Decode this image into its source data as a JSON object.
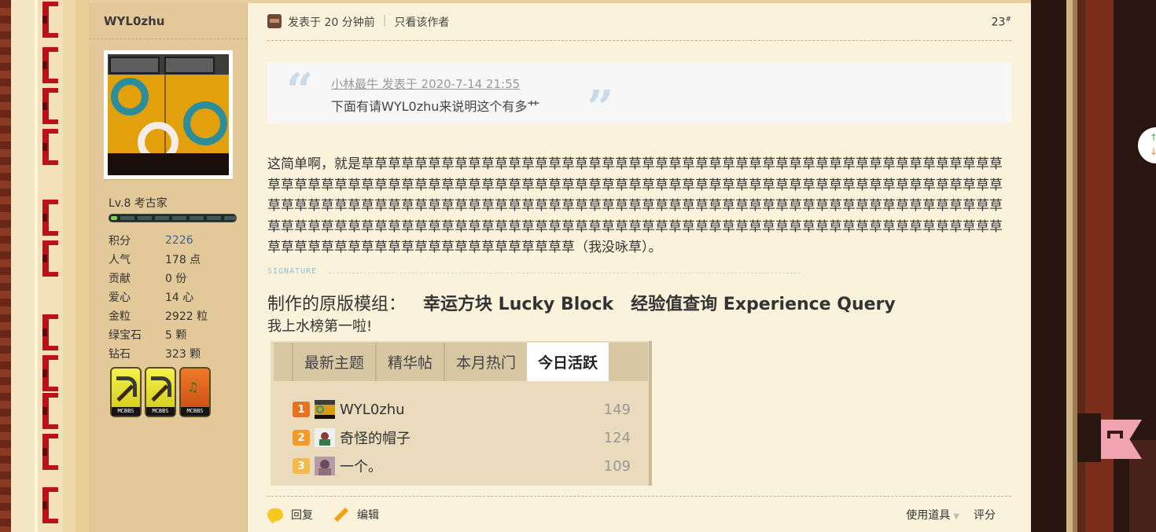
{
  "author": {
    "name": "WYL0zhu",
    "level": "Lv.8 考古家",
    "level_progress": 0.05,
    "stats": [
      {
        "label": "积分",
        "value": "2226"
      },
      {
        "label": "人气",
        "value": "178 点"
      },
      {
        "label": "贡献",
        "value": "0 份"
      },
      {
        "label": "爱心",
        "value": "14 心"
      },
      {
        "label": "金粒",
        "value": "2922 粒"
      },
      {
        "label": "绿宝石",
        "value": "5 颗"
      },
      {
        "label": "钻石",
        "value": "323 颗"
      }
    ],
    "medals": [
      {
        "tag": "MCBBS",
        "icon": "pickaxe-icon",
        "color": "#e6e030"
      },
      {
        "tag": "MCBBS",
        "icon": "pickaxe-icon",
        "color": "#e6e030"
      },
      {
        "tag": "MCBBS",
        "icon": "music-notes-icon",
        "color": "#e0641e"
      }
    ]
  },
  "post": {
    "time": "发表于 20 分钟前",
    "separator": "|",
    "only_author": "只看该作者",
    "floor": "23",
    "floor_sup": "#",
    "quote": {
      "open_mark": "“",
      "close_mark": "”",
      "head": "小林最牛 发表于 2020-7-14 21:55",
      "body": "下面有请WYL0zhu来说明这个有多艹"
    },
    "message": "这简单啊，就是草草草草草草草草草草草草草草草草草草草草草草草草草草草草草草草草草草草草草草草草草草草草草草草草草草草草草草草草草草草草草草草草草草草草草草草草草草草草草草草草草草草草草草草草草草草草草草草草草草草草草草草草草草草草草草草草草草草草草草草草草草草草草草草草草草草草草草草草草草草草草草草草草草草草草草草草草草草草草草草草草草草草草草草草草草草草草草草草草草草草草草草草草草草草草草草草草草草草草草草草草草草草草草草草草草草草草草草草草草草草草草草草草草草草草草草草草草草草（我没咏草）。",
    "signature": {
      "label": "SIGNATURE",
      "line1_prefix": "制作的原版模组：",
      "mod1": "幸运方块 Lucky Block",
      "mod2": "经验值查询 Experience Query",
      "line2": "我上水榜第一啦!"
    },
    "board": {
      "tabs": [
        "最新主题",
        "精华帖",
        "本月热门",
        "今日活跃"
      ],
      "active_tab": "今日活跃",
      "rows": [
        {
          "rank": "1",
          "name": "WYL0zhu",
          "score": "149"
        },
        {
          "rank": "2",
          "name": "奇怪的帽子",
          "score": "124"
        },
        {
          "rank": "3",
          "name": "一个。",
          "score": "109"
        }
      ]
    },
    "footer": {
      "reply": "回复",
      "edit": "编辑",
      "tools": "使用道具",
      "rate": "评分"
    }
  },
  "colors": {
    "post_bg": "#fbf2db",
    "author_bg": "#e3c99a",
    "link": "#336699",
    "accent_red": "#b8131c"
  }
}
